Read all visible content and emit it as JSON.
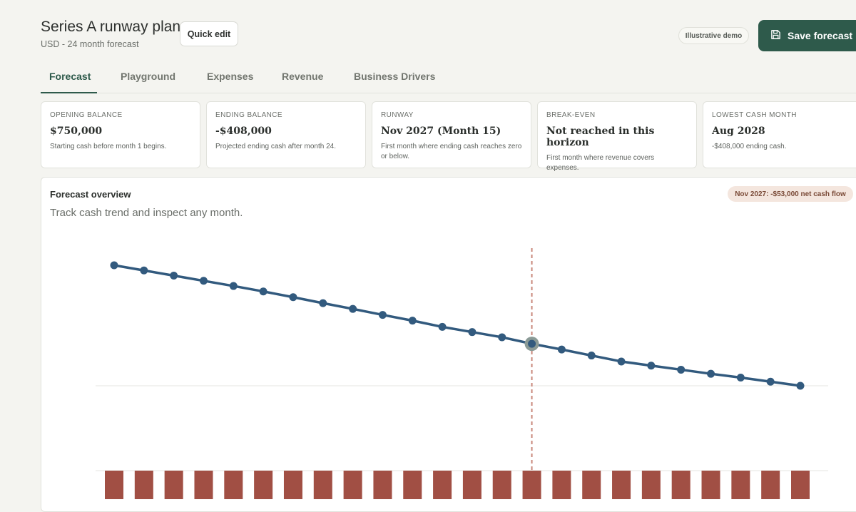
{
  "header": {
    "title": "Series A runway plan",
    "subtitle": "USD - 24 month forecast",
    "quick_edit_label": "Quick edit",
    "demo_badge": "Illustrative demo",
    "save_label": "Save forecast"
  },
  "tabs": [
    {
      "label": "Forecast",
      "active": true
    },
    {
      "label": "Playground",
      "active": false
    },
    {
      "label": "Expenses",
      "active": false
    },
    {
      "label": "Revenue",
      "active": false
    },
    {
      "label": "Business Drivers",
      "active": false
    }
  ],
  "cards": [
    {
      "label": "OPENING BALANCE",
      "value": "$750,000",
      "note": "Starting cash before month 1 begins."
    },
    {
      "label": "ENDING BALANCE",
      "value": "-$408,000",
      "note": "Projected ending cash after month 24."
    },
    {
      "label": "RUNWAY",
      "value": "Nov 2027 (Month 15)",
      "note": "First month where ending cash reaches zero or below."
    },
    {
      "label": "BREAK-EVEN",
      "value": "Not reached in this horizon",
      "note": "First month where revenue covers expenses."
    },
    {
      "label": "LOWEST CASH MONTH",
      "value": "Aug 2028",
      "note": "-$408,000 ending cash."
    }
  ],
  "panel": {
    "title": "Forecast overview",
    "subtitle": "Track cash trend and inspect any month.",
    "badge": "Nov 2027: -$53,000 net cash flow"
  },
  "colors": {
    "accent": "#2e5a4b",
    "line": "#325a7e",
    "bar": "#a14f44",
    "marker": "#c9877a",
    "highlight_ring": "#8a9a96"
  },
  "chart_data": {
    "type": "line",
    "months": 24,
    "highlight_month": 15,
    "cash_balance": [
      714000,
      695000,
      676000,
      657000,
      638000,
      618000,
      597000,
      575000,
      554000,
      532000,
      511000,
      488000,
      469000,
      450000,
      426000,
      405000,
      383000,
      361000,
      346000,
      331000,
      316000,
      302000,
      287000,
      272000
    ],
    "y_zero_reference": 0,
    "net_cash_flow_bars": 24,
    "grid": true,
    "legend": "none"
  }
}
